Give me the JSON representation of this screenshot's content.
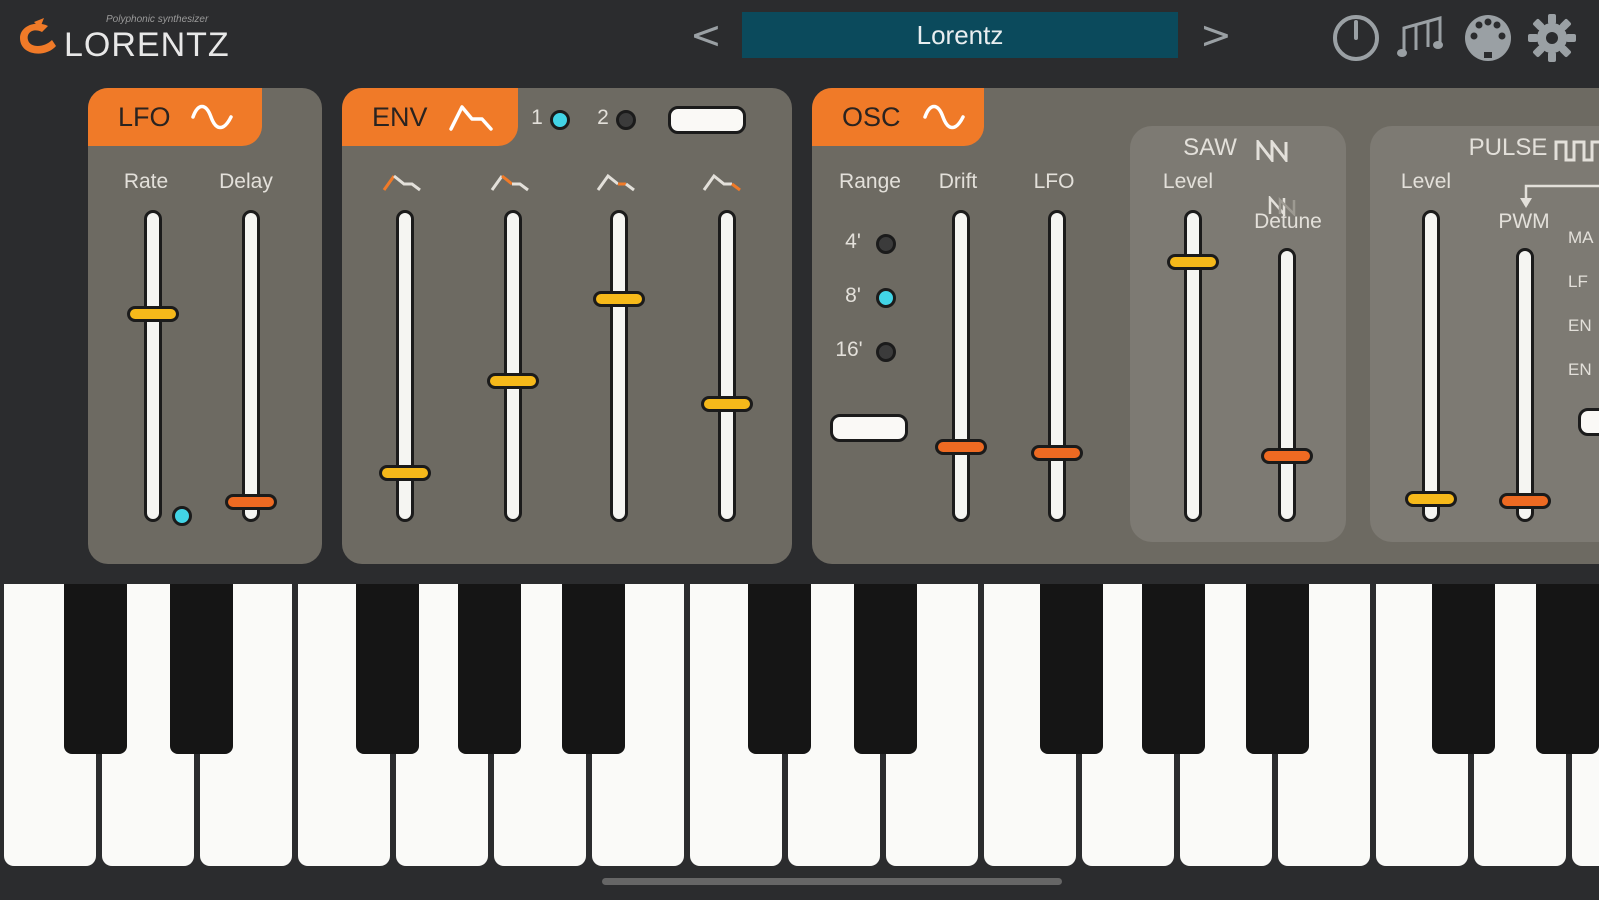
{
  "app": {
    "logo_word": "LORENTZ",
    "logo_tagline": "Polyphonic synthesizer",
    "preset_name": "Lorentz",
    "prev_label": "<",
    "next_label": ">",
    "icons": [
      "power-icon",
      "music-notes-icon",
      "midi-connector-icon",
      "gear-icon"
    ]
  },
  "lfo": {
    "title": "LFO",
    "labels": {
      "rate": "Rate",
      "delay": "Delay"
    },
    "values": {
      "rate": 0.68,
      "delay": 0.03
    }
  },
  "env": {
    "title": "ENV",
    "selector_1": "1",
    "selector_2": "2",
    "selected": "1",
    "values": {
      "attack": 0.13,
      "decay": 0.45,
      "sustain": 0.73,
      "release": 0.37
    }
  },
  "osc": {
    "title": "OSC",
    "range_label": "Range",
    "range_options": [
      "4'",
      "8'",
      "16'"
    ],
    "range_selected": "8'",
    "drift_label": "Drift",
    "lfo_label": "LFO",
    "values": {
      "drift": 0.22,
      "lfo": 0.2
    },
    "saw": {
      "title": "SAW",
      "level_label": "Level",
      "detune_label": "Detune",
      "values": {
        "level": 0.86,
        "detune": 0.22
      }
    },
    "pulse": {
      "title": "PULSE",
      "level_label": "Level",
      "pwm_label": "PWM",
      "mod_sources": [
        "MA",
        "LF",
        "EN",
        "EN"
      ],
      "values": {
        "level": 0.04,
        "pwm": 0.04
      }
    }
  },
  "colors": {
    "accent_orange": "#f07a28",
    "slider_yellow": "#f6b91a",
    "slider_orange": "#ee6a22",
    "led_on": "#42d4e6",
    "preset_bg": "#0b4a5c"
  }
}
